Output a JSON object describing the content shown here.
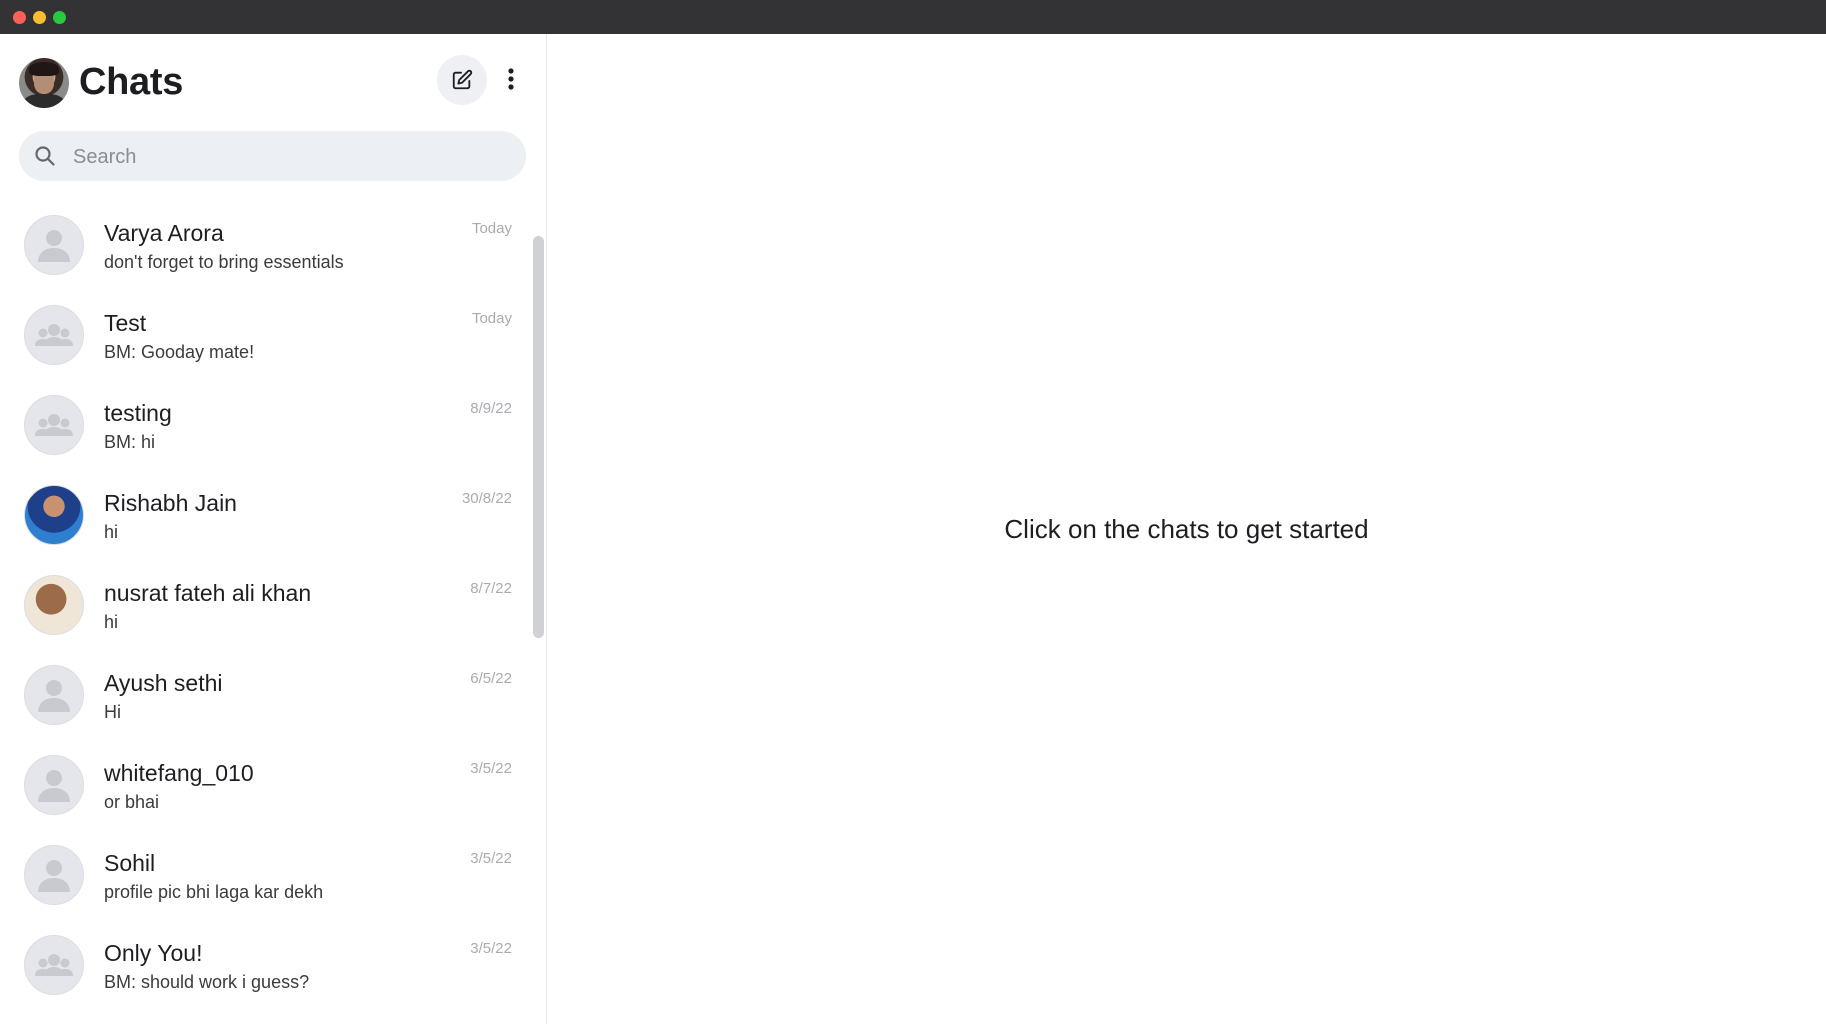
{
  "window": {
    "title": ""
  },
  "sidebar": {
    "title": "Chats",
    "compose_icon": "compose-icon",
    "more_icon": "more-vertical-icon",
    "search": {
      "placeholder": "Search",
      "value": "",
      "icon": "search-icon"
    },
    "chats": [
      {
        "name": "Varya Arora",
        "preview": "don't forget to bring essentials",
        "date": "Today",
        "avatar": "person-placeholder"
      },
      {
        "name": "Test",
        "preview": "BM: Gooday mate!",
        "date": "Today",
        "avatar": "group-placeholder"
      },
      {
        "name": "testing",
        "preview": "BM: hi",
        "date": "8/9/22",
        "avatar": "group-placeholder"
      },
      {
        "name": "Rishabh Jain",
        "preview": "hi",
        "date": "30/8/22",
        "avatar": "photo"
      },
      {
        "name": "nusrat fateh ali khan",
        "preview": "hi",
        "date": "8/7/22",
        "avatar": "photo"
      },
      {
        "name": "Ayush sethi",
        "preview": "Hi",
        "date": "6/5/22",
        "avatar": "person-placeholder"
      },
      {
        "name": "whitefang_010",
        "preview": "or bhai",
        "date": "3/5/22",
        "avatar": "person-placeholder"
      },
      {
        "name": "Sohil",
        "preview": "profile pic bhi laga kar dekh",
        "date": "3/5/22",
        "avatar": "person-placeholder"
      },
      {
        "name": "Only You!",
        "preview": "BM: should work i guess?",
        "date": "3/5/22",
        "avatar": "group-placeholder"
      }
    ]
  },
  "main": {
    "empty_message": "Click on the chats to get started"
  }
}
